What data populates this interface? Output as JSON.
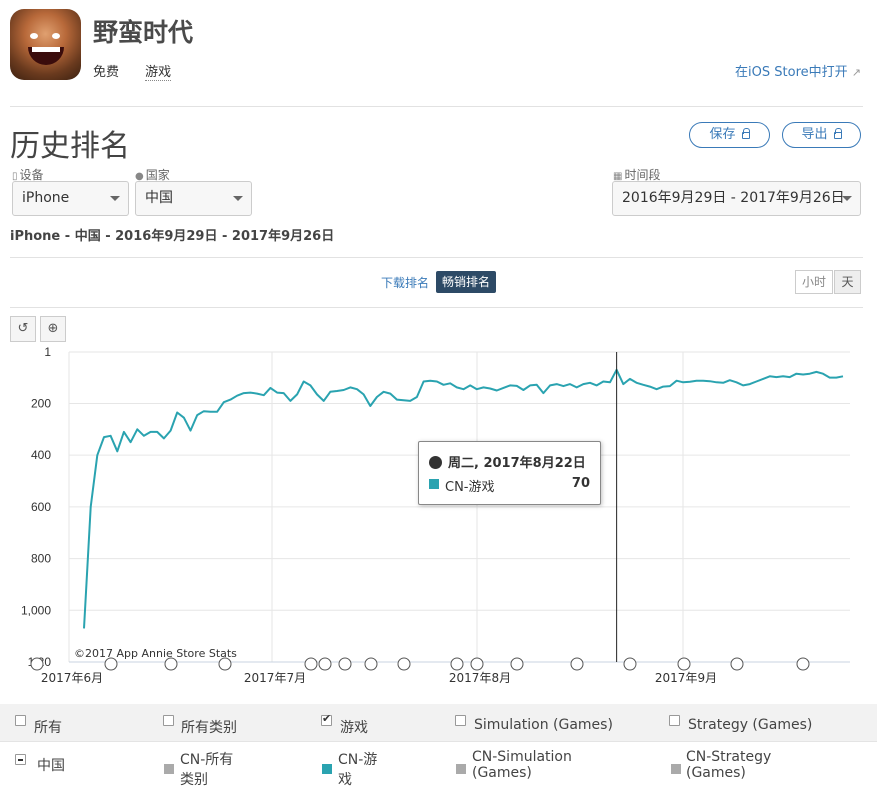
{
  "app": {
    "name": "野蛮时代",
    "price": "免费",
    "genre": "游戏",
    "store_link": "在iOS Store中打开"
  },
  "section": {
    "title": "历史排名",
    "save_label": "保存",
    "export_label": "导出"
  },
  "filters": {
    "device_label": "设备",
    "device_value": "iPhone",
    "country_label": "国家",
    "country_value": "中国",
    "period_label": "时间段",
    "period_value": "2016年9月29日 - 2017年9月26日",
    "summary": "iPhone - 中国 - 2016年9月29日 - 2017年9月26日"
  },
  "tabs": {
    "downloads": "下载排名",
    "grossing": "畅销排名",
    "hour": "小时",
    "day": "天"
  },
  "chart_data": {
    "type": "line",
    "y_ticks": [
      "1",
      "200",
      "400",
      "600",
      "800",
      "1,000",
      "1,20"
    ],
    "ylim": [
      1,
      1200
    ],
    "y_inverted": true,
    "x_ticks": [
      "2017年6月",
      "2017年7月",
      "2017年8月",
      "2017年9月"
    ],
    "copyright": "©2017 App Annie Store Stats",
    "series": [
      {
        "name": "CN-游戏",
        "color": "#2aa3b0",
        "values": [
          1070,
          600,
          400,
          330,
          325,
          385,
          310,
          350,
          300,
          325,
          310,
          310,
          335,
          305,
          235,
          255,
          305,
          245,
          230,
          232,
          232,
          195,
          185,
          170,
          160,
          158,
          162,
          168,
          140,
          158,
          160,
          190,
          165,
          115,
          130,
          165,
          190,
          155,
          152,
          148,
          138,
          145,
          165,
          210,
          175,
          155,
          162,
          185,
          188,
          190,
          175,
          115,
          112,
          115,
          128,
          122,
          138,
          145,
          130,
          145,
          138,
          142,
          150,
          140,
          130,
          132,
          148,
          130,
          128,
          160,
          130,
          125,
          133,
          125,
          138,
          125,
          120,
          130,
          115,
          118,
          70,
          125,
          105,
          120,
          128,
          135,
          145,
          135,
          133,
          112,
          118,
          116,
          112,
          112,
          114,
          118,
          120,
          110,
          118,
          130,
          125,
          115,
          105,
          95,
          98,
          95,
          98,
          85,
          88,
          85,
          78,
          85,
          100,
          100,
          95
        ]
      }
    ],
    "hover": {
      "date": "周二, 2017年8月22日",
      "series": "CN-游戏",
      "value": 70
    }
  },
  "legend": {
    "headers": [
      "所有",
      "所有类别",
      "游戏",
      "Simulation (Games)",
      "Strategy (Games)"
    ],
    "row_country": "中国",
    "items": [
      {
        "line1": "CN-所有",
        "line2": "类别",
        "color": "#aaaaaa"
      },
      {
        "line1": "CN-游",
        "line2": "戏",
        "color": "#2aa3b0"
      },
      {
        "line1": "CN-Simulation",
        "line2": "(Games)",
        "color": "#aaaaaa"
      },
      {
        "line1": "CN-Strategy",
        "line2": "(Games)",
        "color": "#aaaaaa"
      }
    ]
  }
}
